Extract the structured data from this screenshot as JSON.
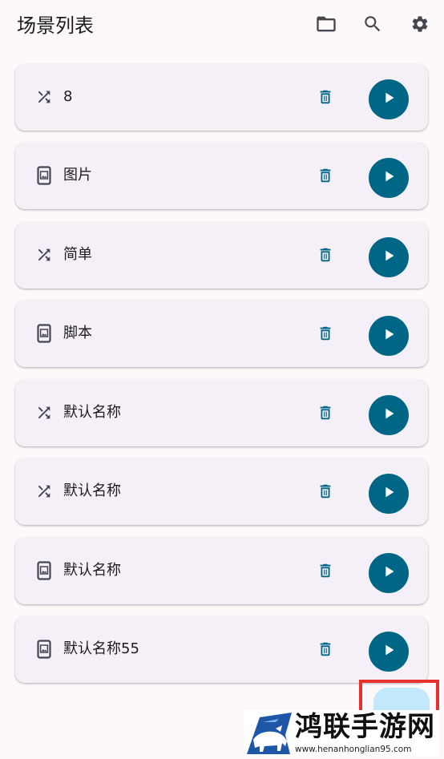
{
  "appbar": {
    "title": "场景列表",
    "actions": [
      {
        "icon": "folder-open-icon"
      },
      {
        "icon": "search-icon"
      },
      {
        "icon": "gear-icon"
      }
    ]
  },
  "scenes": [
    {
      "label": "8",
      "icon": "shuffle-icon"
    },
    {
      "label": "图片",
      "icon": "phone-image-icon"
    },
    {
      "label": "简单",
      "icon": "shuffle-icon"
    },
    {
      "label": "脚本",
      "icon": "phone-image-icon"
    },
    {
      "label": "默认名称",
      "icon": "shuffle-icon"
    },
    {
      "label": "默认名称",
      "icon": "shuffle-icon"
    },
    {
      "label": "默认名称",
      "icon": "phone-image-icon"
    },
    {
      "label": "默认名称55",
      "icon": "phone-image-icon"
    }
  ],
  "item_actions": {
    "delete_icon": "trash-icon",
    "play_icon": "play-icon"
  },
  "watermark": {
    "text": "鸿联手游网",
    "url": "www.henanhonglian95.com"
  },
  "colors": {
    "background": "#fdf9fb",
    "card": "#f5eff7",
    "primary": "#006685",
    "fab": "#c1e8fb",
    "highlight": "#e5322f"
  }
}
